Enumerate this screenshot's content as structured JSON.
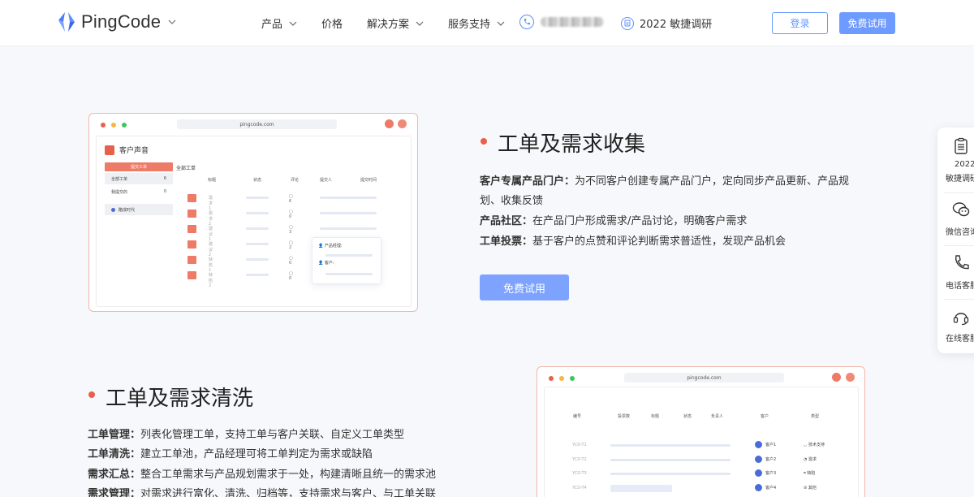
{
  "header": {
    "logo_text": "PingCode",
    "nav": [
      {
        "label": "产品",
        "has_dropdown": true
      },
      {
        "label": "价格",
        "has_dropdown": false
      },
      {
        "label": "解决方案",
        "has_dropdown": true
      },
      {
        "label": "服务支持",
        "has_dropdown": true
      }
    ],
    "survey_label": "2022 敏捷调研",
    "login_label": "登录",
    "trial_label": "免费试用",
    "accent_color": "#6e9bff"
  },
  "section1": {
    "title": "工单及需求收集",
    "lines": [
      {
        "key": "客户专属产品门户：",
        "text": "为不同客户创建专属产品门户，定向同步产品更新、产品规"
      },
      {
        "key": "",
        "text": "划、收集反馈"
      },
      {
        "key": "产品社区：",
        "text": "在产品门户形成需求/产品讨论，明确客户需求"
      },
      {
        "key": "工单投票：",
        "text": "基于客户的点赞和评论判断需求普适性，发现产品机会"
      }
    ],
    "cta_label": "免费试用",
    "mock": {
      "url": "pingcode.com",
      "app_title": "客户声音",
      "submit_button": "提交工单",
      "sidebar": [
        {
          "label": "全部工单",
          "count": "6"
        },
        {
          "label": "我提交的",
          "count": "0"
        },
        {
          "label": "酷成时代",
          "count": ""
        }
      ],
      "subtitle": "全部工单",
      "columns": [
        "标题",
        "状态",
        "评论",
        "提交人",
        "提交时间"
      ],
      "rows": [
        {
          "name": "需求1",
          "comments": "6"
        },
        {
          "name": "需求2",
          "comments": "0"
        },
        {
          "name": "建议1",
          "comments": "3"
        },
        {
          "name": "建议2",
          "comments": "2"
        },
        {
          "name": "缺陷1",
          "comments": "0"
        },
        {
          "name": "缺陷2",
          "comments": "0"
        }
      ],
      "popover": [
        "产品经理:",
        "客户:"
      ]
    }
  },
  "section2": {
    "title": "工单及需求清洗",
    "lines": [
      {
        "key": "工单管理：",
        "text": "列表化管理工单，支持工单与客户关联、自定义工单类型"
      },
      {
        "key": "工单清洗：",
        "text": "建立工单池，产品经理可将工单判定为需求或缺陷"
      },
      {
        "key": "需求汇总：",
        "text": "整合工单需求与产品规划需求于一处，构建清晰且统一的需求池"
      },
      {
        "key": "需求管理：",
        "text": "对需求进行富化、清洗、归档等，支持需求与客户、与工单关联"
      }
    ],
    "mock": {
      "url": "pingcode.com",
      "columns": [
        "编号",
        "投票数",
        "标题",
        "状态",
        "负责人",
        "客户",
        "类型"
      ],
      "rows": [
        {
          "id": "YCD-T1",
          "customer": "客户1",
          "type": "技术支持"
        },
        {
          "id": "YCD-T2",
          "customer": "客户2",
          "type": "需求"
        },
        {
          "id": "YCD-T3",
          "customer": "客户3",
          "type": "缺陷"
        },
        {
          "id": "YCD-T4",
          "customer": "客户4",
          "type": "其他"
        }
      ]
    }
  },
  "float_bar": {
    "items": [
      {
        "line1": "2022",
        "line2": "敏捷调研",
        "icon": "clipboard-icon"
      },
      {
        "line1": "",
        "line2": "微信咨询",
        "icon": "wechat-icon"
      },
      {
        "line1": "",
        "line2": "电话客服",
        "icon": "phone-icon"
      },
      {
        "line1": "",
        "line2": "在线客服",
        "icon": "headset-icon"
      }
    ]
  }
}
